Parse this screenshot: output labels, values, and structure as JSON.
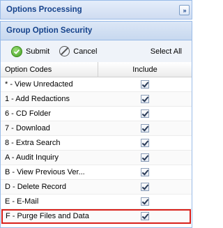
{
  "panel": {
    "title": "Options Processing",
    "collapse_glyph": "»"
  },
  "section": {
    "title": "Group Option Security"
  },
  "toolbar": {
    "submit_label": "Submit",
    "cancel_label": "Cancel",
    "select_all_label": "Select All"
  },
  "grid": {
    "columns": [
      "Option Codes",
      "Include"
    ],
    "rows": [
      {
        "code": "* - View Unredacted",
        "include": true
      },
      {
        "code": "1 - Add Redactions",
        "include": true
      },
      {
        "code": "6 - CD Folder",
        "include": true
      },
      {
        "code": "7 - Download",
        "include": true
      },
      {
        "code": "8 - Extra Search",
        "include": true
      },
      {
        "code": "A - Audit Inquiry",
        "include": true
      },
      {
        "code": "B - View Previous Ver...",
        "include": true
      },
      {
        "code": "D - Delete Record",
        "include": true
      },
      {
        "code": "E - E-Mail",
        "include": true
      },
      {
        "code": "F - Purge Files and Data",
        "include": true
      }
    ]
  },
  "colors": {
    "header_text": "#15428b",
    "border": "#99bbe8",
    "highlight": "#d9201a"
  }
}
